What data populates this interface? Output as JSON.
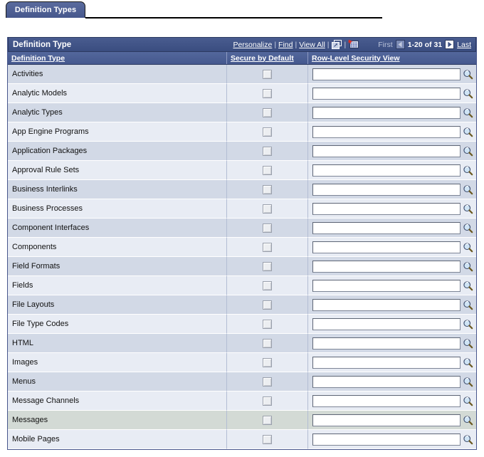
{
  "tab": {
    "label": "Definition Types",
    "name": "definition-types-tab"
  },
  "grid": {
    "title": "Definition Type",
    "toolbar": {
      "personalize": "Personalize",
      "find": "Find",
      "view_all": "View All",
      "separator": "|",
      "zoom_icon": "zoom-icon",
      "download_icon": "download-to-spreadsheet-icon"
    },
    "navigation": {
      "first_label": "First",
      "prev_icon": "previous-arrow-icon",
      "range": "1-20 of 31",
      "next_icon": "next-arrow-icon",
      "last_label": "Last"
    },
    "columns": [
      {
        "label": "Definition Type",
        "key": "definition-type"
      },
      {
        "label": "Secure by Default",
        "key": "secure-by-default"
      },
      {
        "label": "Row-Level Security View",
        "key": "row-level-security-view"
      }
    ],
    "rows": [
      {
        "definition_type": "Activities",
        "secure_by_default": false,
        "row_level_security_view": "",
        "highlighted": false
      },
      {
        "definition_type": "Analytic Models",
        "secure_by_default": false,
        "row_level_security_view": "",
        "highlighted": false
      },
      {
        "definition_type": "Analytic Types",
        "secure_by_default": false,
        "row_level_security_view": "",
        "highlighted": false
      },
      {
        "definition_type": "App Engine Programs",
        "secure_by_default": false,
        "row_level_security_view": "",
        "highlighted": false
      },
      {
        "definition_type": "Application Packages",
        "secure_by_default": false,
        "row_level_security_view": "",
        "highlighted": false
      },
      {
        "definition_type": "Approval Rule Sets",
        "secure_by_default": false,
        "row_level_security_view": "",
        "highlighted": false
      },
      {
        "definition_type": "Business Interlinks",
        "secure_by_default": false,
        "row_level_security_view": "",
        "highlighted": false
      },
      {
        "definition_type": "Business Processes",
        "secure_by_default": false,
        "row_level_security_view": "",
        "highlighted": false
      },
      {
        "definition_type": "Component Interfaces",
        "secure_by_default": false,
        "row_level_security_view": "",
        "highlighted": false
      },
      {
        "definition_type": "Components",
        "secure_by_default": false,
        "row_level_security_view": "",
        "highlighted": false
      },
      {
        "definition_type": "Field Formats",
        "secure_by_default": false,
        "row_level_security_view": "",
        "highlighted": false
      },
      {
        "definition_type": "Fields",
        "secure_by_default": false,
        "row_level_security_view": "",
        "highlighted": false
      },
      {
        "definition_type": "File Layouts",
        "secure_by_default": false,
        "row_level_security_view": "",
        "highlighted": false
      },
      {
        "definition_type": "File Type Codes",
        "secure_by_default": false,
        "row_level_security_view": "",
        "highlighted": false
      },
      {
        "definition_type": "HTML",
        "secure_by_default": false,
        "row_level_security_view": "",
        "highlighted": false
      },
      {
        "definition_type": "Images",
        "secure_by_default": false,
        "row_level_security_view": "",
        "highlighted": false
      },
      {
        "definition_type": "Menus",
        "secure_by_default": false,
        "row_level_security_view": "",
        "highlighted": false
      },
      {
        "definition_type": "Message Channels",
        "secure_by_default": false,
        "row_level_security_view": "",
        "highlighted": false
      },
      {
        "definition_type": "Messages",
        "secure_by_default": false,
        "row_level_security_view": "",
        "highlighted": true
      },
      {
        "definition_type": "Mobile Pages",
        "secure_by_default": false,
        "row_level_security_view": "",
        "highlighted": false
      }
    ]
  },
  "colors": {
    "tab_fill": "#4c5d91",
    "titlebar": "#3f5285",
    "column_header": "#4a5e94",
    "row_odd": "#d2d9e6",
    "row_even": "#e8ecf4",
    "row_highlight": "#d3dad5",
    "grid_border": "#47568c"
  }
}
